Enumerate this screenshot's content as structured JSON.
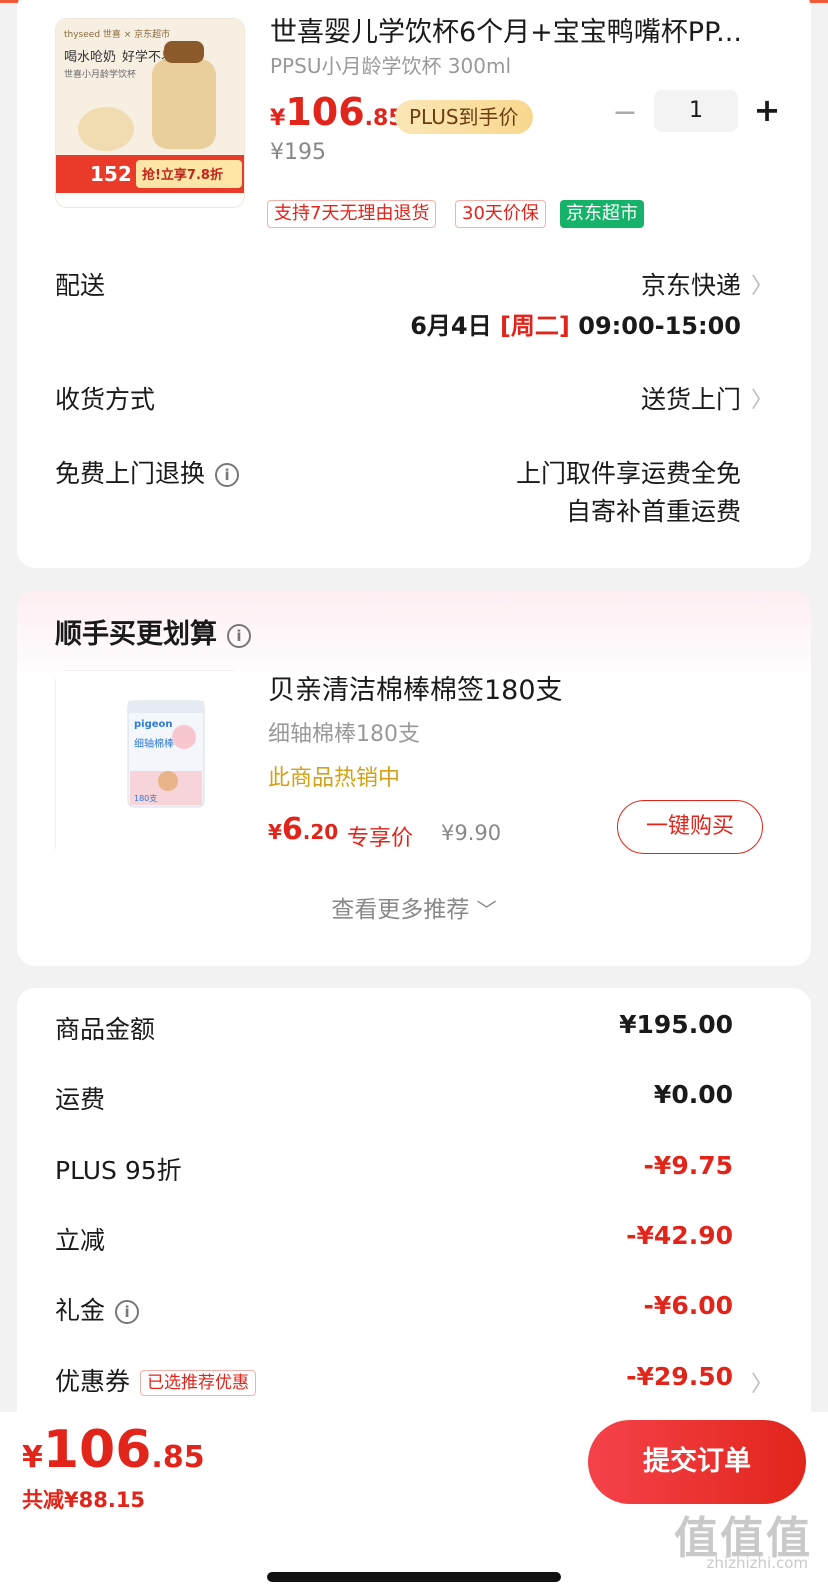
{
  "product": {
    "title": "世喜婴儿学饮杯6个月+宝宝鸭嘴杯PP...",
    "spec": "PPSU小月龄学饮杯 300ml",
    "price_yen": "¥",
    "price_int": "106",
    "price_dec": ".85",
    "plus_badge": "PLUS到手价",
    "original_price": "¥195",
    "quantity": "1",
    "minus_label": "−",
    "plus_label": "+",
    "tags": [
      "支持7天无理由退货",
      "30天价保",
      "京东超市"
    ],
    "image_text": {
      "brand": "thyseed 世喜 × 京东超市",
      "headline1": "喝水呛奶",
      "headline2": "好学不易呛",
      "sub": "世喜小月龄学饮杯",
      "promo_price": "152",
      "promo_cta": "抢!立享7.8折"
    }
  },
  "delivery": {
    "label": "配送",
    "carrier": "京东快递",
    "date_prefix": "6月4日",
    "day": "[周二]",
    "time": "09:00-15:00"
  },
  "receive": {
    "label": "收货方式",
    "value": "送货上门"
  },
  "return": {
    "label": "免费上门退换",
    "line1": "上门取件享运费全免",
    "line2": "自寄补首重运费"
  },
  "recommend": {
    "title": "顺手买更划算",
    "item_name": "贝亲清洁棉棒棉签180支",
    "item_spec": "细轴棉棒180支",
    "hot": "此商品热销中",
    "price_yen": "¥",
    "price_int": "6",
    "price_dec": ".20",
    "price_tag": "专享价",
    "original_price": "¥9.90",
    "buy_button": "一键购买",
    "more": "查看更多推荐",
    "image_brand": "pigeon",
    "image_label": "细轴棉棒",
    "image_count": "180支"
  },
  "summary": {
    "rows": [
      {
        "label": "商品金额",
        "value": "¥195.00",
        "red": false
      },
      {
        "label": "运费",
        "value": "¥0.00",
        "red": false
      },
      {
        "label": "PLUS 95折",
        "value": "-¥9.75",
        "red": true
      },
      {
        "label": "立减",
        "value": "-¥42.90",
        "red": true
      },
      {
        "label": "礼金",
        "value": "-¥6.00",
        "red": true
      },
      {
        "label": "优惠券",
        "value": "-¥29.50",
        "red": true
      }
    ],
    "coupon_tag": "已选推荐优惠"
  },
  "bottom": {
    "total_yen": "¥",
    "total_int": "106",
    "total_dec": ".85",
    "saved": "共减¥88.15",
    "submit": "提交订单"
  },
  "watermark": {
    "main": "值值值",
    "sub": "zhizhizhi.com"
  },
  "colors": {
    "accent_red": "#e1251b",
    "supermarket_green": "#17b26a",
    "plus_gold": "#f8d88f"
  },
  "icons": [
    "info-icon",
    "chevron-right-icon",
    "chevron-down-icon",
    "minus-icon",
    "plus-icon"
  ]
}
